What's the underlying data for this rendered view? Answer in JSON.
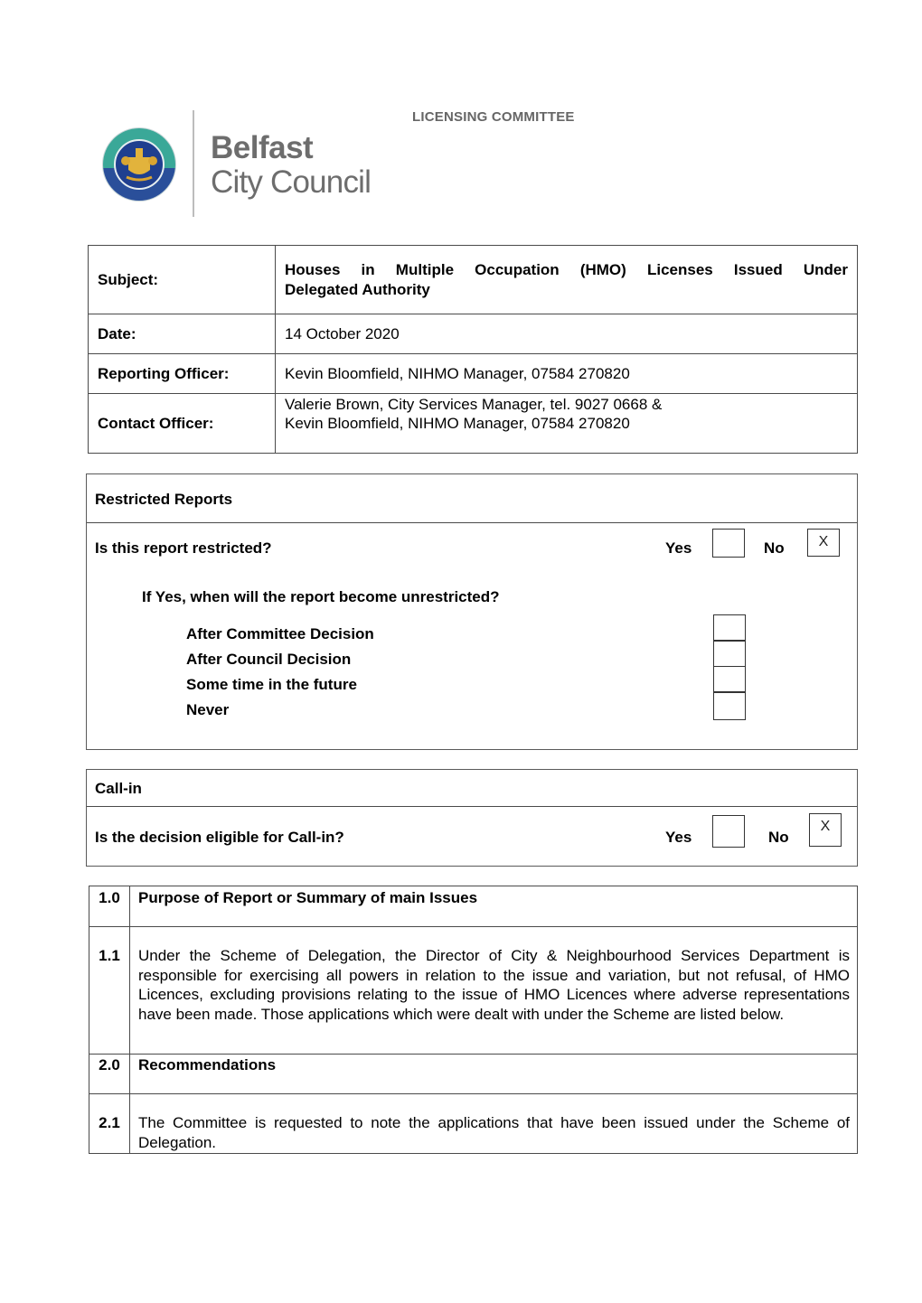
{
  "header": {
    "committee": "LICENSING COMMITTEE",
    "logo": {
      "line1": "Belfast",
      "line2": "City Council",
      "crest_icon": "belfast-city-council-crest"
    }
  },
  "info_table": {
    "rows": [
      {
        "label": "Subject:",
        "line1": "Houses in Multiple Occupation (HMO) Licenses Issued Under",
        "line2": "Delegated Authority"
      },
      {
        "label": "Date:",
        "value": "14 October 2020"
      },
      {
        "label": "Reporting Officer:",
        "value": "Kevin Bloomfield, NIHMO Manager, 07584 270820"
      },
      {
        "label": "Contact Officer:",
        "line1": "Valerie Brown, City Services Manager, tel. 9027 0668 &",
        "line2": "Kevin Bloomfield, NIHMO Manager, 07584 270820"
      }
    ]
  },
  "restricted": {
    "title": "Restricted Reports",
    "question": "Is this report restricted?",
    "yes_label": "Yes",
    "no_label": "No",
    "yes_mark": "",
    "no_mark": "X",
    "followup": "If Yes, when will the report become unrestricted?",
    "options": [
      {
        "label": "After Committee Decision",
        "mark": ""
      },
      {
        "label": "After Council Decision",
        "mark": ""
      },
      {
        "label": "Some time in the future",
        "mark": ""
      },
      {
        "label": "Never",
        "mark": ""
      }
    ]
  },
  "callin": {
    "title": "Call-in",
    "question": "Is the decision eligible for Call-in?",
    "yes_label": "Yes",
    "no_label": "No",
    "yes_mark": "",
    "no_mark": "X"
  },
  "sections": [
    {
      "num": "1.0",
      "text": "Purpose of Report or Summary of main Issues",
      "heading": true
    },
    {
      "num": "1.1",
      "text": "Under the Scheme of Delegation, the Director of City & Neighbourhood Services Department is responsible for exercising all powers in relation to the issue and variation, but not refusal, of HMO Licences, excluding provisions relating to the issue of HMO Licences where adverse representations have been made. Those applications which were dealt with under the Scheme are listed below.",
      "heading": false
    },
    {
      "num": "2.0",
      "text": "Recommendations",
      "heading": true
    },
    {
      "num": "2.1",
      "text": "The Committee is requested to note the applications that have been issued under the Scheme of Delegation.",
      "heading": false
    }
  ]
}
